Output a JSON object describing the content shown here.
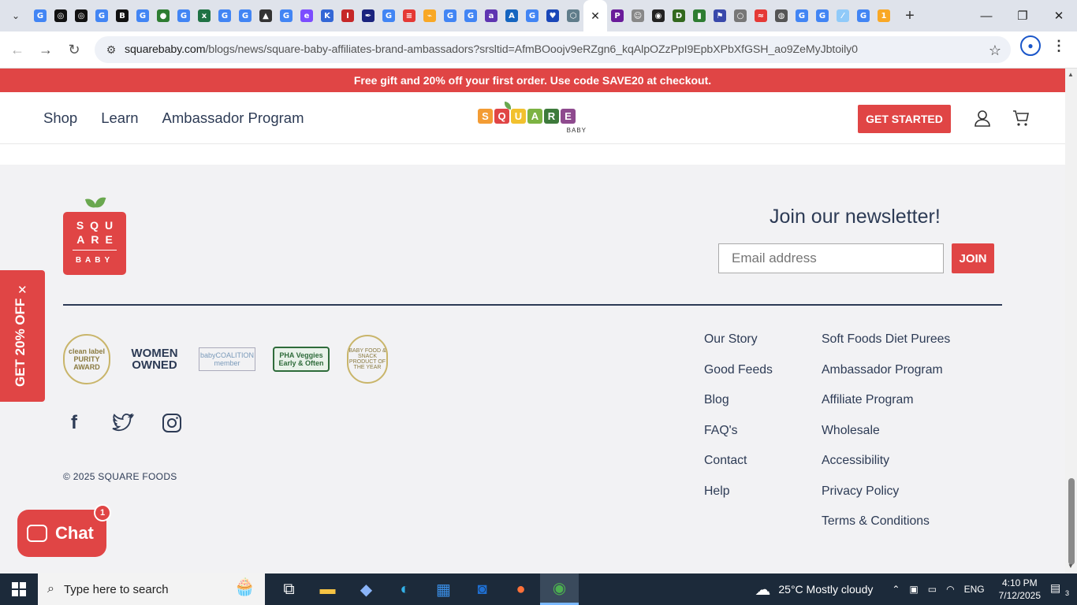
{
  "browser": {
    "tab_favicons": [
      {
        "name": "google",
        "glyph": "G",
        "color": "#4285f4"
      },
      {
        "name": "openai",
        "glyph": "◎",
        "color": "#111"
      },
      {
        "name": "openai",
        "glyph": "◎",
        "color": "#111"
      },
      {
        "name": "google",
        "glyph": "G",
        "color": "#4285f4"
      },
      {
        "name": "bold-b",
        "glyph": "B",
        "color": "#111"
      },
      {
        "name": "google",
        "glyph": "G",
        "color": "#4285f4"
      },
      {
        "name": "globe",
        "glyph": "●",
        "color": "#2e7d32"
      },
      {
        "name": "google",
        "glyph": "G",
        "color": "#4285f4"
      },
      {
        "name": "excel",
        "glyph": "x",
        "color": "#1f7244"
      },
      {
        "name": "google",
        "glyph": "G",
        "color": "#4285f4"
      },
      {
        "name": "google",
        "glyph": "G",
        "color": "#4285f4"
      },
      {
        "name": "mortarboard",
        "glyph": "▲",
        "color": "#333"
      },
      {
        "name": "google",
        "glyph": "G",
        "color": "#4285f4"
      },
      {
        "name": "circle-e",
        "glyph": "e",
        "color": "#7c4dff"
      },
      {
        "name": "k-logo",
        "glyph": "K",
        "color": "#3367d6"
      },
      {
        "name": "i-logo",
        "glyph": "I",
        "color": "#c62828"
      },
      {
        "name": "pen",
        "glyph": "✒",
        "color": "#1a237e"
      },
      {
        "name": "google",
        "glyph": "G",
        "color": "#4285f4"
      },
      {
        "name": "list",
        "glyph": "≡",
        "color": "#e53935"
      },
      {
        "name": "zigzag",
        "glyph": "⌁",
        "color": "#f9a825"
      },
      {
        "name": "google",
        "glyph": "G",
        "color": "#4285f4"
      },
      {
        "name": "google",
        "glyph": "G",
        "color": "#4285f4"
      },
      {
        "name": "affirm",
        "glyph": "a",
        "color": "#5e35b1"
      },
      {
        "name": "az",
        "glyph": "A",
        "color": "#1565c0"
      },
      {
        "name": "google",
        "glyph": "G",
        "color": "#4285f4"
      },
      {
        "name": "heart",
        "glyph": "♥",
        "color": "#1a47b8"
      },
      {
        "name": "hex",
        "glyph": "⬡",
        "color": "#607d8b"
      }
    ],
    "tab_favicons_right": [
      {
        "name": "ip",
        "glyph": "P",
        "color": "#6a1b9a"
      },
      {
        "name": "face",
        "glyph": "☺",
        "color": "#888"
      },
      {
        "name": "panda",
        "glyph": "◉",
        "color": "#222"
      },
      {
        "name": "green-d",
        "glyph": "D",
        "color": "#33691e"
      },
      {
        "name": "chart",
        "glyph": "▮",
        "color": "#2e7d32"
      },
      {
        "name": "flag",
        "glyph": "⚑",
        "color": "#3949ab"
      },
      {
        "name": "ring",
        "glyph": "○",
        "color": "#777"
      },
      {
        "name": "flame",
        "glyph": "≈",
        "color": "#e53935"
      },
      {
        "name": "earth",
        "glyph": "◍",
        "color": "#555"
      },
      {
        "name": "google",
        "glyph": "G",
        "color": "#4285f4"
      },
      {
        "name": "google",
        "glyph": "G",
        "color": "#4285f4"
      },
      {
        "name": "feather",
        "glyph": "⁄",
        "color": "#90caf9"
      },
      {
        "name": "google",
        "glyph": "G",
        "color": "#4285f4"
      },
      {
        "name": "one",
        "glyph": "1",
        "color": "#f9a825"
      }
    ],
    "url_domain": "squarebaby.com",
    "url_path": "/blogs/news/square-baby-affiliates-brand-ambassadors?srsltid=AfmBOoojv9eRZgn6_kqAlpOZzPpI9EpbXPbXfGSH_ao9ZeMyJbtoily0"
  },
  "site": {
    "promo_bar": "Free gift and 20% off your first order. Use code SAVE20 at checkout.",
    "nav": [
      "Shop",
      "Learn",
      "Ambassador Program"
    ],
    "logo_letters": [
      {
        "ch": "S",
        "color": "#f39c34"
      },
      {
        "ch": "Q",
        "color": "#e04545"
      },
      {
        "ch": "U",
        "color": "#f2c12e"
      },
      {
        "ch": "A",
        "color": "#7cb342"
      },
      {
        "ch": "R",
        "color": "#3d7a3b"
      },
      {
        "ch": "E",
        "color": "#8e4a8e"
      }
    ],
    "logo_sub": "BABY",
    "cta": "GET STARTED",
    "accent": "#e04545"
  },
  "footer": {
    "logo_lines": [
      "SQU",
      "ARE",
      "BABY"
    ],
    "newsletter_title": "Join our newsletter!",
    "email_placeholder": "Email address",
    "join_label": "JOIN",
    "badges": {
      "clean": "clean label PURITY AWARD",
      "women": "WOMEN OWNED",
      "coalition": "babyCOALITION member",
      "pha": "PHA Veggies Early & Often",
      "seal": "BABY FOOD & SNACK PRODUCT OF THE YEAR"
    },
    "copyright": "© 2025 SQUARE FOODS",
    "col1": [
      "Our Story",
      "Good Feeds",
      "Blog",
      "FAQ's",
      "Contact",
      "Help"
    ],
    "col2": [
      "Soft Foods Diet Purees",
      "Ambassador Program",
      "Affiliate Program",
      "Wholesale",
      "Accessibility",
      "Privacy Policy",
      "Terms & Conditions"
    ]
  },
  "overlays": {
    "side_promo": "GET 20% OFF",
    "chat_label": "Chat",
    "chat_badge": "1"
  },
  "taskbar": {
    "search_placeholder": "Type here to search",
    "weather": "25°C  Mostly cloudy",
    "lang": "ENG",
    "time": "4:10 PM",
    "date": "7/12/2025",
    "notif_count": "3"
  }
}
